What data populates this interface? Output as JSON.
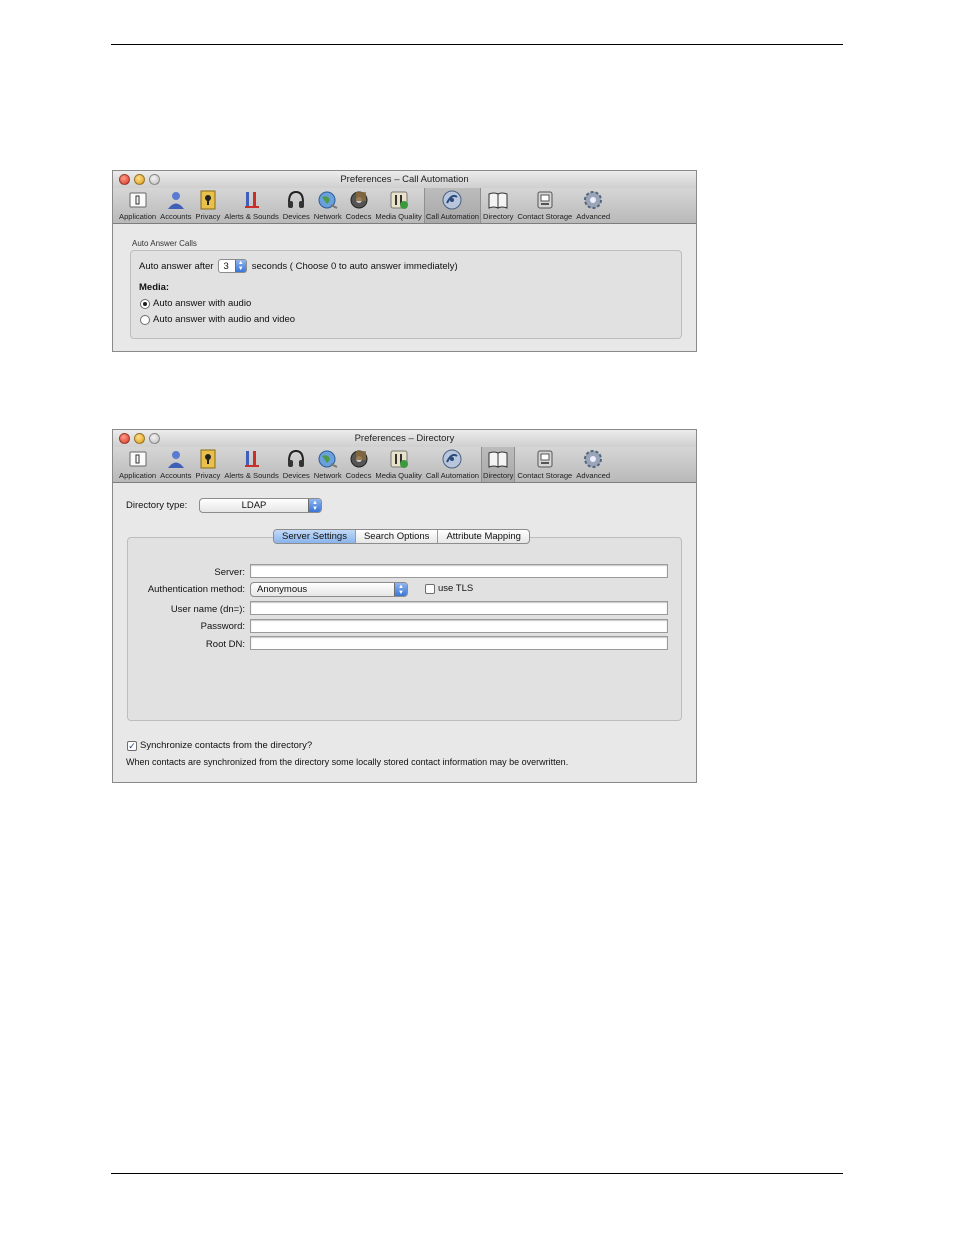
{
  "toolbar_items": [
    {
      "label": "Application",
      "icon": "application-icon"
    },
    {
      "label": "Accounts",
      "icon": "accounts-icon"
    },
    {
      "label": "Privacy",
      "icon": "privacy-icon"
    },
    {
      "label": "Alerts & Sounds",
      "icon": "alerts-sounds-icon"
    },
    {
      "label": "Devices",
      "icon": "headset-icon"
    },
    {
      "label": "Network",
      "icon": "network-globe-icon"
    },
    {
      "label": "Codecs",
      "icon": "codecs-film-icon"
    },
    {
      "label": "Media Quality",
      "icon": "media-quality-icon"
    },
    {
      "label": "Call Automation",
      "icon": "call-automation-icon"
    },
    {
      "label": "Directory",
      "icon": "directory-book-icon"
    },
    {
      "label": "Contact Storage",
      "icon": "contact-storage-icon"
    },
    {
      "label": "Advanced",
      "icon": "advanced-gear-icon"
    }
  ],
  "win1": {
    "title": "Preferences – Call Automation",
    "active_tab": "Call Automation",
    "group_title": "Auto Answer Calls",
    "auto_answer_label": "Auto answer after",
    "auto_answer_seconds": "3",
    "seconds_hint": "seconds ( Choose 0 to auto answer immediately)",
    "media_label": "Media:",
    "radio_audio": "Auto answer with audio",
    "radio_audio_video": "Auto answer with audio and video",
    "selected_media": "Auto answer with audio"
  },
  "win2": {
    "title": "Preferences – Directory",
    "active_tab": "Directory",
    "directory_type_label": "Directory type:",
    "directory_type_value": "LDAP",
    "tabs": [
      "Server Settings",
      "Search Options",
      "Attribute Mapping"
    ],
    "active_subtab": "Server Settings",
    "server_label": "Server:",
    "server_value": "",
    "auth_label": "Authentication method:",
    "auth_value": "Anonymous",
    "use_tls_label": "use TLS",
    "use_tls_checked": false,
    "username_label": "User name (dn=):",
    "username_value": "",
    "password_label": "Password:",
    "password_value": "",
    "rootdn_label": "Root DN:",
    "rootdn_value": "",
    "sync_label": "Synchronize contacts from the directory?",
    "sync_checked": true,
    "sync_note": "When contacts are synchronized from the directory some locally stored contact information may be overwritten."
  },
  "colors": {
    "window_bg": "#e8e8e8",
    "toolbar_bg": "#c6c6c6",
    "accent_blue": "#3a76d6",
    "close": "#d9361e",
    "minimize": "#d99a12"
  }
}
